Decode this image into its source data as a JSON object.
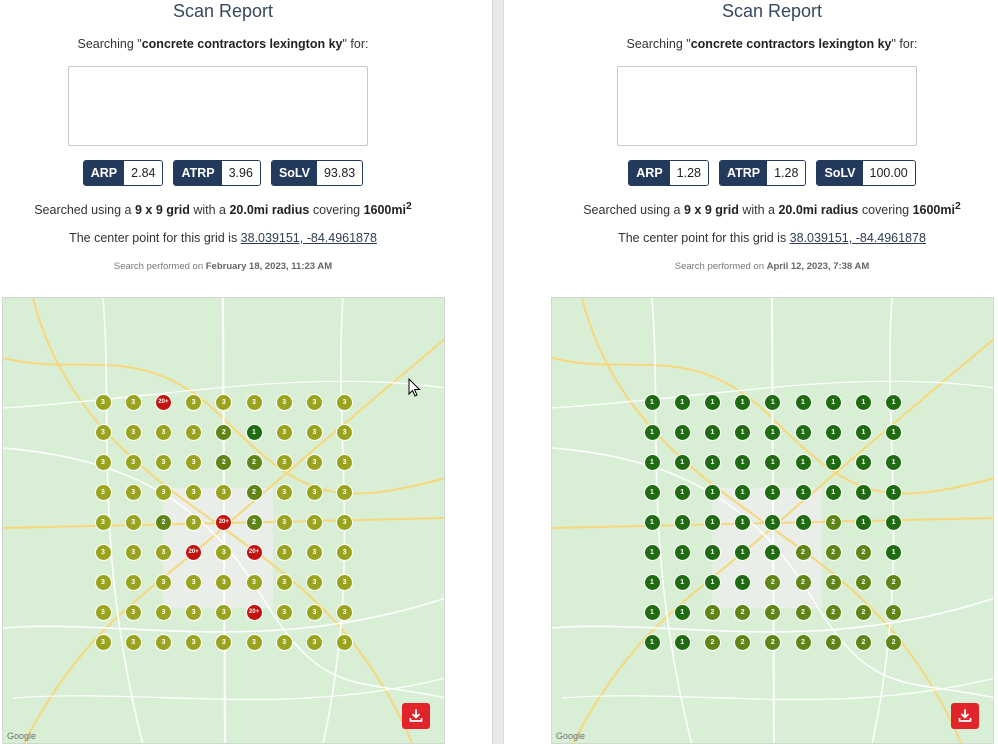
{
  "panels": [
    {
      "title": "Scan Report",
      "search_prefix": "Searching \"",
      "query": "concrete contractors lexington ky",
      "search_suffix": "\" for:",
      "metrics": [
        {
          "label": "ARP",
          "value": "2.84"
        },
        {
          "label": "ATRP",
          "value": "3.96"
        },
        {
          "label": "SoLV",
          "value": "93.83"
        }
      ],
      "searched": {
        "prefix": "Searched using a ",
        "grid": "9 x 9 grid",
        "mid": " with a ",
        "radius": "20.0mi radius",
        "covering": " covering ",
        "area": "1600mi",
        "area_sup": "2"
      },
      "center": {
        "prefix": "The center point for this grid is ",
        "coords": "38.039151, -84.4961878"
      },
      "performed": {
        "prefix": "Search performed on ",
        "date": "February 18, 2023, 11:23 AM"
      },
      "grid_ranks": [
        [
          "3",
          "3",
          "20+",
          "3",
          "3",
          "3",
          "3",
          "3",
          "3"
        ],
        [
          "3",
          "3",
          "3",
          "3",
          "2",
          "1",
          "3",
          "3",
          "3"
        ],
        [
          "3",
          "3",
          "3",
          "3",
          "2",
          "2",
          "3",
          "3",
          "3"
        ],
        [
          "3",
          "3",
          "3",
          "3",
          "3",
          "2",
          "3",
          "3",
          "3"
        ],
        [
          "3",
          "3",
          "2",
          "3",
          "20+",
          "2",
          "3",
          "3",
          "3"
        ],
        [
          "3",
          "3",
          "3",
          "20+",
          "3",
          "20+",
          "3",
          "3",
          "3"
        ],
        [
          "3",
          "3",
          "3",
          "3",
          "3",
          "3",
          "3",
          "3",
          "3"
        ],
        [
          "3",
          "3",
          "3",
          "3",
          "3",
          "20+",
          "3",
          "3",
          "3"
        ],
        [
          "3",
          "3",
          "3",
          "3",
          "3",
          "3",
          "3",
          "3",
          "3"
        ]
      ],
      "download_icon": "download-icon"
    },
    {
      "title": "Scan Report",
      "search_prefix": "Searching \"",
      "query": "concrete contractors lexington ky",
      "search_suffix": "\" for:",
      "metrics": [
        {
          "label": "ARP",
          "value": "1.28"
        },
        {
          "label": "ATRP",
          "value": "1.28"
        },
        {
          "label": "SoLV",
          "value": "100.00"
        }
      ],
      "searched": {
        "prefix": "Searched using a ",
        "grid": "9 x 9 grid",
        "mid": " with a ",
        "radius": "20.0mi radius",
        "covering": " covering ",
        "area": "1600mi",
        "area_sup": "2"
      },
      "center": {
        "prefix": "The center point for this grid is ",
        "coords": "38.039151, -84.4961878"
      },
      "performed": {
        "prefix": "Search performed on ",
        "date": "April 12, 2023, 7:38 AM"
      },
      "grid_ranks": [
        [
          "1",
          "1",
          "1",
          "1",
          "1",
          "1",
          "1",
          "1",
          "1"
        ],
        [
          "1",
          "1",
          "1",
          "1",
          "1",
          "1",
          "1",
          "1",
          "1"
        ],
        [
          "1",
          "1",
          "1",
          "1",
          "1",
          "1",
          "1",
          "1",
          "1"
        ],
        [
          "1",
          "1",
          "1",
          "1",
          "1",
          "1",
          "1",
          "1",
          "1"
        ],
        [
          "1",
          "1",
          "1",
          "1",
          "1",
          "1",
          "2",
          "1",
          "1"
        ],
        [
          "1",
          "1",
          "1",
          "1",
          "1",
          "2",
          "2",
          "2",
          "1"
        ],
        [
          "1",
          "1",
          "1",
          "1",
          "2",
          "2",
          "2",
          "2",
          "2"
        ],
        [
          "1",
          "1",
          "2",
          "2",
          "2",
          "2",
          "2",
          "2",
          "2"
        ],
        [
          "1",
          "1",
          "2",
          "2",
          "2",
          "2",
          "2",
          "2",
          "2"
        ]
      ],
      "download_icon": "download-icon"
    }
  ],
  "map_attribution": "Google",
  "rank_colors": {
    "1": "#1f6b12",
    "2": "#5e8516",
    "3": "#9aa31e",
    "20+": "#c2140f"
  }
}
